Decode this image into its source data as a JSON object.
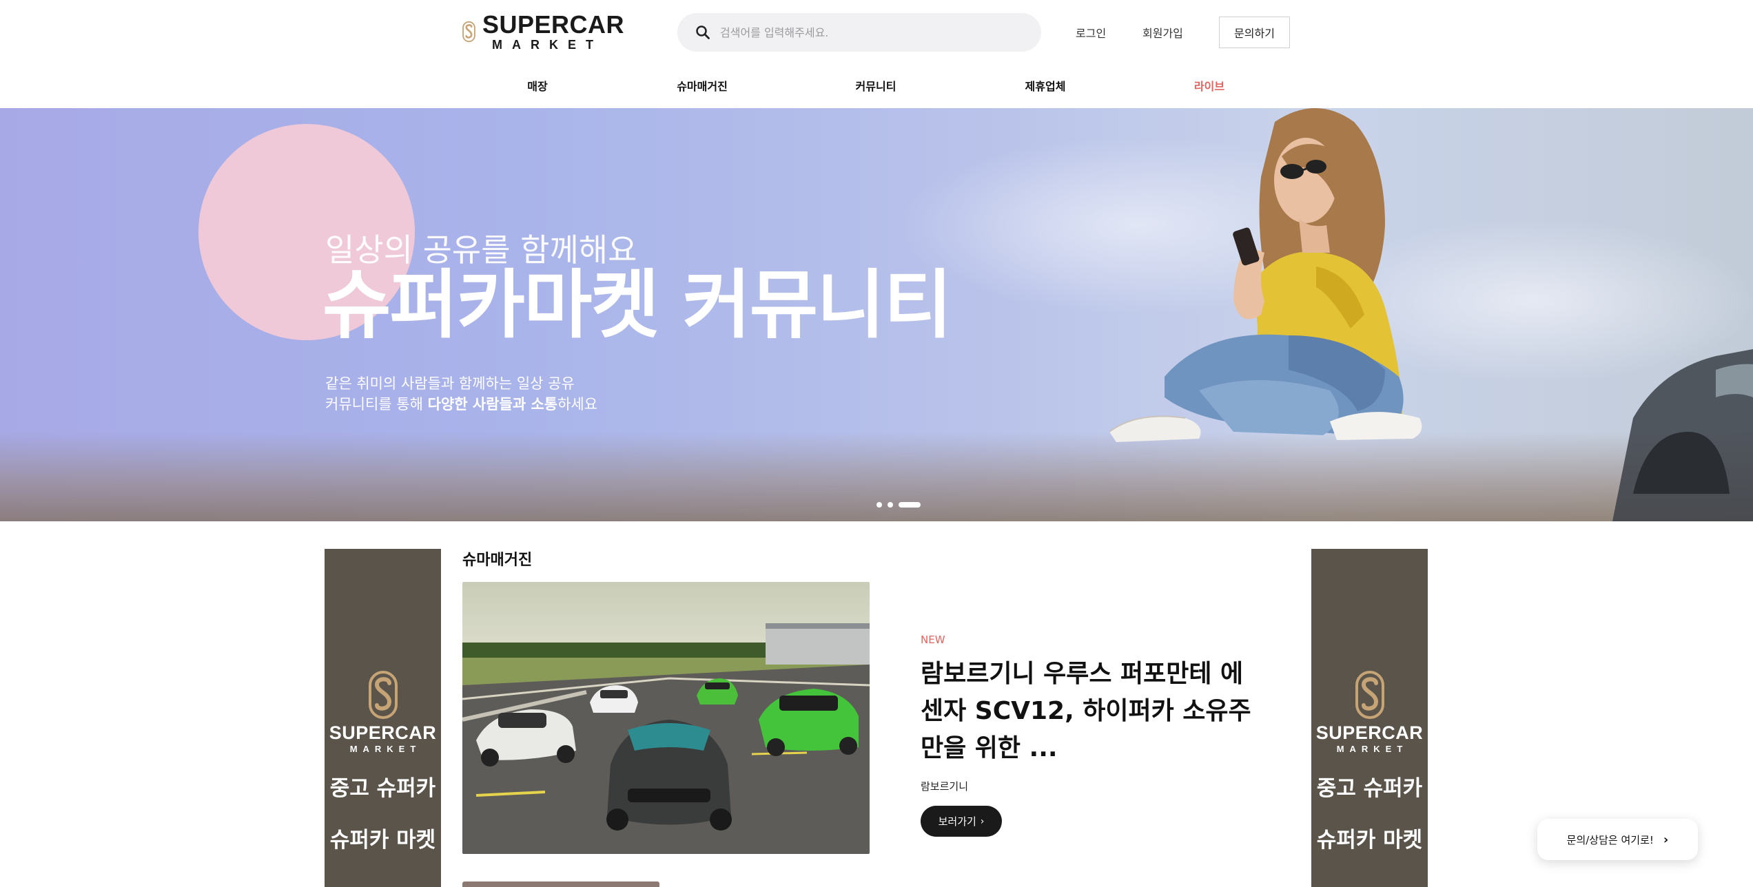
{
  "brand": {
    "logo_top": "SUPERCAR",
    "logo_bottom": "MARKET",
    "accent": "#e2645e",
    "logo_gold": "#c7a476"
  },
  "search": {
    "placeholder": "검색어를 입력해주세요."
  },
  "header_links": {
    "login": "로그인",
    "signup": "회원가입",
    "inquiry": "문의하기"
  },
  "nav": [
    {
      "label": "매장"
    },
    {
      "label": "슈마매거진"
    },
    {
      "label": "커뮤니티"
    },
    {
      "label": "제휴업체"
    },
    {
      "label": "라이브"
    }
  ],
  "hero": {
    "subtitle": "일상의 공유를 함께해요",
    "title": "슈퍼카마켓 커뮤니티",
    "desc_line1": "같은 취미의 사람들과 함께하는 일상 공유",
    "desc_line2_pre": "커뮤니티를 통해 ",
    "desc_line2_bold": "다양한 사람들과 소통",
    "desc_line2_post": "하세요",
    "slide_count": 3,
    "active_slide": 3
  },
  "side_banner": {
    "logo_top": "SUPERCAR",
    "logo_bottom": "MARKET",
    "line1": "중고 슈퍼카",
    "line2": "슈퍼카 마켓",
    "bg": "#5a544b"
  },
  "magazine": {
    "section_title": "슈마매거진",
    "badge": "NEW",
    "title": "람보르기니 우루스 퍼포만테 에센자 SCV12, 하이퍼카 소유주만을 위한 ...",
    "brand": "람보르기니",
    "button": "보러가기"
  },
  "floating": {
    "label": "문의/상담은 여기로!"
  }
}
